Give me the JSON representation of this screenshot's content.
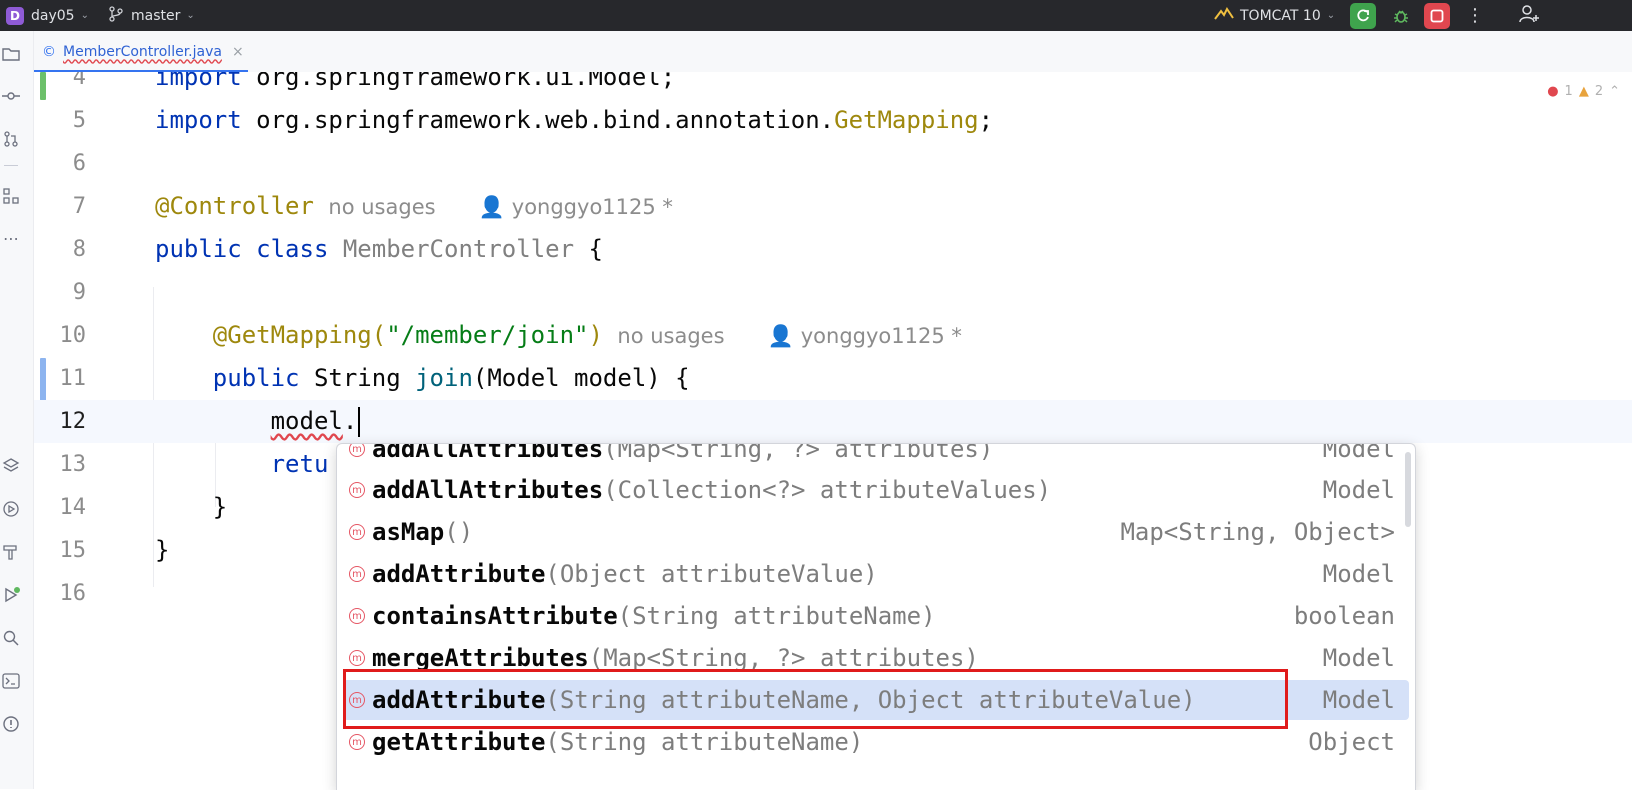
{
  "titlebar": {
    "project_badge": "D",
    "project": "day05",
    "branch": "master",
    "run_config": "TOMCAT 10"
  },
  "tab": {
    "filename": "MemberController.java",
    "close": "×",
    "class_icon": "©"
  },
  "inspection": {
    "errors": "1",
    "warnings": "2"
  },
  "editor": {
    "lines": [
      {
        "num": "4"
      },
      {
        "num": "5"
      },
      {
        "num": "6"
      },
      {
        "num": "7"
      },
      {
        "num": "8"
      },
      {
        "num": "9"
      },
      {
        "num": "10"
      },
      {
        "num": "11"
      },
      {
        "num": "12"
      },
      {
        "num": "13"
      },
      {
        "num": "14"
      },
      {
        "num": "15"
      },
      {
        "num": "16"
      }
    ],
    "code": {
      "l4_kw": "import",
      "l4_rest": " org.springframework.ui.Model;",
      "l5_kw": "import",
      "l5_pkg": " org.springframework.web.bind.annotation.",
      "l5_cls": "GetMapping",
      "l5_end": ";",
      "l7_ann": "@Controller",
      "l7_usages": "no usages",
      "l7_author": "yonggyo1125 *",
      "l8_kw1": "public",
      "l8_kw2": "class",
      "l8_cls": "MemberController",
      "l8_end": " {",
      "l10_ann": "@GetMapping(",
      "l10_str": "\"/member/join\"",
      "l10_end": ")",
      "l10_usages": "no usages",
      "l10_author": "yonggyo1125 *",
      "l11_kw": "public",
      "l11_type": " String ",
      "l11_fn": "join",
      "l11_rest": "(Model model) {",
      "l12_var": "model",
      "l12_dot": ".",
      "l13_text": "retu",
      "l14_text": "}",
      "l15_text": "}"
    }
  },
  "completion": {
    "items": [
      {
        "name": "addAllAttributes",
        "params": "(Map<String, ?> attributes)",
        "type": "Model",
        "icon": "m"
      },
      {
        "name": "addAllAttributes",
        "params": "(Collection<?> attributeValues)",
        "type": "Model",
        "icon": "m"
      },
      {
        "name": "asMap",
        "params": "()",
        "type": "Map<String, Object>",
        "icon": "m"
      },
      {
        "name": "addAttribute",
        "params": "(Object attributeValue)",
        "type": "Model",
        "icon": "m"
      },
      {
        "name": "containsAttribute",
        "params": "(String attributeName)",
        "type": "boolean",
        "icon": "m"
      },
      {
        "name": "mergeAttributes",
        "params": "(Map<String, ?> attributes)",
        "type": "Model",
        "icon": "m"
      },
      {
        "name": "addAttribute",
        "params": "(String attributeName, Object attributeValue)",
        "type": "Model",
        "icon": "m"
      },
      {
        "name": "getAttribute",
        "params": "(String attributeName)",
        "type": "Object",
        "icon": "m"
      }
    ]
  },
  "colors": {
    "keyword": "#0033b3",
    "annotation": "#9e880d",
    "string": "#067d17",
    "selection": "#d5e1f8",
    "highlight_box": "#e01b1b",
    "titlebar_bg": "#27282c"
  }
}
